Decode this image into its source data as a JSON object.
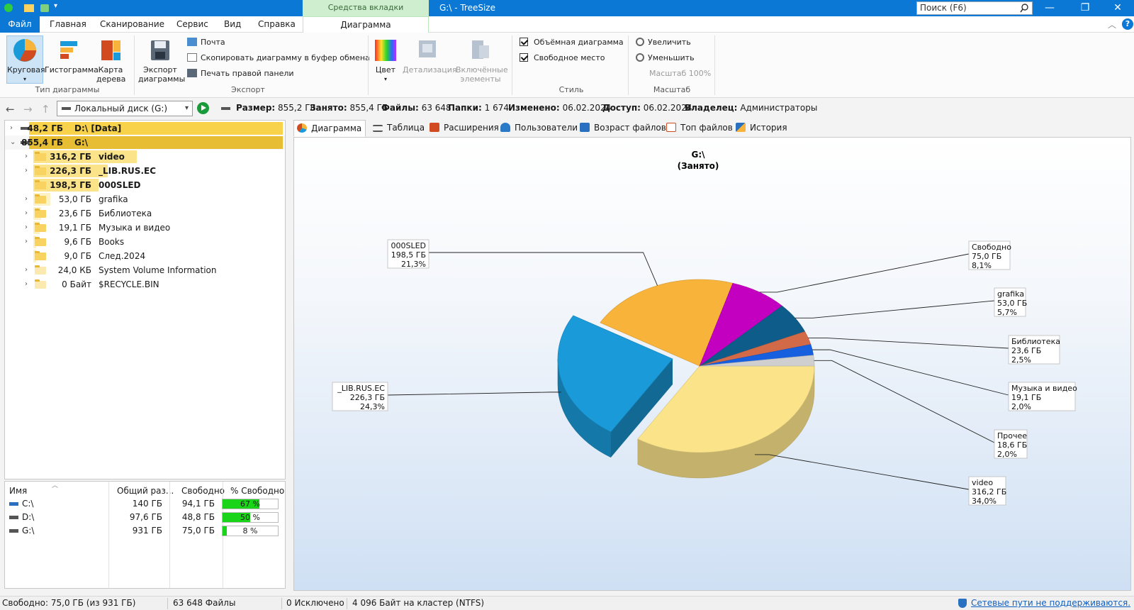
{
  "window": {
    "context_tab": "Средства вкладки \"Диаграмма\"",
    "title": "G:\\ - TreeSize",
    "search_label": "Поиск (F6)"
  },
  "menu": {
    "tabs": [
      "Файл",
      "Главная",
      "Сканирование",
      "Сервис",
      "Вид",
      "Справка"
    ],
    "active_tab": "Диаграмма"
  },
  "ribbon": {
    "chart_type": {
      "buttons": [
        "Круговая",
        "Гистограмма",
        "Карта дерева"
      ],
      "group_label": "Тип диаграммы"
    },
    "export": {
      "big_button": "Экспорт диаграммы",
      "mail": "Почта",
      "copy": "Скопировать диаграмму в буфер обмена",
      "print": "Печать правой панели",
      "group_label": "Экспорт"
    },
    "style": {
      "color": "Цвет",
      "detail": "Детализация",
      "included": "Включённые элементы",
      "check_3d": "Объёмная диаграмма",
      "check_free": "Свободное место",
      "group_label": "Стиль"
    },
    "zoom": {
      "zoom_in": "Увеличить",
      "zoom_out": "Уменьшить",
      "zoom_level": "Масштаб 100%",
      "group_label": "Масштаб"
    }
  },
  "addressbar": {
    "drive": "Локальный диск (G:)",
    "size_label": "Размер:",
    "size": "855,2 ГБ",
    "used_label": "Занято:",
    "used": "855,4 ГБ",
    "files_label": "Файлы:",
    "files": "63 648",
    "folders_label": "Папки:",
    "folders": "1 674",
    "modified_label": "Изменено:",
    "modified": "06.02.2024",
    "access_label": "Доступ:",
    "access": "06.02.2024",
    "owner_label": "Владелец:",
    "owner": "Администраторы"
  },
  "tree": {
    "roots": [
      {
        "size": "48,2 ГБ",
        "name": "D:\\   [Data]",
        "fill": 1.0
      },
      {
        "size": "855,4 ГБ",
        "name": "G:\\",
        "fill": 1.0
      }
    ],
    "items": [
      {
        "size": "316,2 ГБ",
        "name": "video",
        "fill": 0.37,
        "bold": true
      },
      {
        "size": "226,3 ГБ",
        "name": "_LIB.RUS.EC",
        "fill": 0.265,
        "bold": true
      },
      {
        "size": "198,5 ГБ",
        "name": "000SLED",
        "fill": 0.232,
        "bold": true
      },
      {
        "size": "53,0 ГБ",
        "name": "grafika",
        "fill": 0.062
      },
      {
        "size": "23,6 ГБ",
        "name": "Библиотека",
        "fill": 0.028
      },
      {
        "size": "19,1 ГБ",
        "name": "Музыка и видео",
        "fill": 0.022
      },
      {
        "size": "9,6 ГБ",
        "name": "Books",
        "fill": 0.011
      },
      {
        "size": "9,0 ГБ",
        "name": "След.2024",
        "fill": 0.011
      },
      {
        "size": "24,0 КБ",
        "name": "System Volume Information",
        "fill": 0.0
      },
      {
        "size": "0 Байт",
        "name": "$RECYCLE.BIN",
        "fill": 0.0
      }
    ]
  },
  "drives": {
    "headers": [
      "Имя",
      "Общий раз...",
      "Свободно",
      "% Свободно"
    ],
    "rows": [
      {
        "name": "C:\\",
        "total": "140 ГБ",
        "free": "94,1 ГБ",
        "pct_label": "67 %",
        "pct": 67
      },
      {
        "name": "D:\\",
        "total": "97,6 ГБ",
        "free": "48,8 ГБ",
        "pct_label": "50 %",
        "pct": 50
      },
      {
        "name": "G:\\",
        "total": "931 ГБ",
        "free": "75,0 ГБ",
        "pct_label": "8 %",
        "pct": 8
      }
    ]
  },
  "chart_tabs": [
    "Диаграмма",
    "Таблица",
    "Расширения",
    "Пользователи",
    "Возраст файлов",
    "Топ файлов",
    "История"
  ],
  "chart_data": {
    "type": "pie",
    "title": "G:\\",
    "subtitle": "(Занято)",
    "slices": [
      {
        "name": "video",
        "size": "316,2 ГБ",
        "pct": "34,0%",
        "value": 34.0,
        "color": "#fbe38a"
      },
      {
        "name": "_LIB.RUS.EC",
        "size": "226,3 ГБ",
        "pct": "24,3%",
        "value": 24.3,
        "color": "#1a9ad8"
      },
      {
        "name": "000SLED",
        "size": "198,5 ГБ",
        "pct": "21,3%",
        "value": 21.3,
        "color": "#f8b33a"
      },
      {
        "name": "Свободно",
        "size": "75,0 ГБ",
        "pct": "8,1%",
        "value": 8.1,
        "color": "#c400c0"
      },
      {
        "name": "grafika",
        "size": "53,0 ГБ",
        "pct": "5,7%",
        "value": 5.7,
        "color": "#0e5c8a"
      },
      {
        "name": "Библиотека",
        "size": "23,6 ГБ",
        "pct": "2,5%",
        "value": 2.5,
        "color": "#d26a48"
      },
      {
        "name": "Музыка и видео",
        "size": "19,1 ГБ",
        "pct": "2,0%",
        "value": 2.0,
        "color": "#1660e0"
      },
      {
        "name": "Прочее",
        "size": "18,6 ГБ",
        "pct": "2,0%",
        "value": 2.0,
        "color": "#cfcfcf"
      }
    ]
  },
  "statusbar": {
    "free": "Свободно: 75,0 ГБ  (из 931 ГБ)",
    "files": "63 648 Файлы",
    "excluded": "0 Исключено",
    "cluster": "4 096 Байт на кластер (NTFS)",
    "network": "Сетевые пути не поддерживаются."
  }
}
